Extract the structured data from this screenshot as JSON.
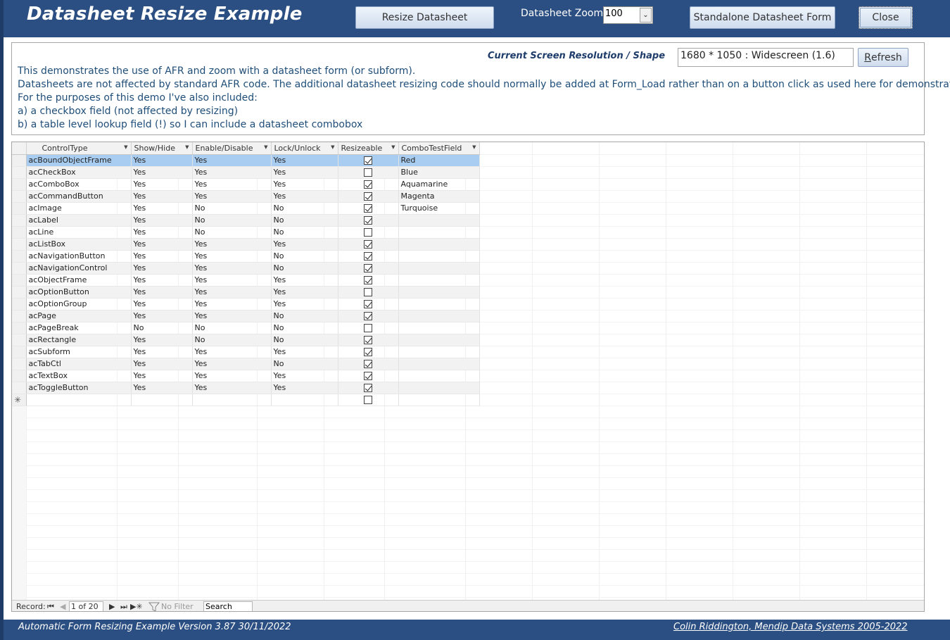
{
  "header": {
    "title": "Datasheet Resize Example",
    "resize_label": "Resize Datasheet",
    "zoom_label": "Datasheet Zoom",
    "zoom_value": "100",
    "standalone_label": "Standalone Datasheet Form",
    "close_label": "Close"
  },
  "info": {
    "resolution_label": "Current Screen Resolution / Shape",
    "resolution_value": "1680 * 1050 : Widescreen (1.6)",
    "refresh_first": "R",
    "refresh_rest": "efresh",
    "lines": [
      "This demonstrates the use of AFR and zoom with a datasheet form (or subform).",
      "Datasheets are not affected by standard AFR code. The additional datasheet resizing code should normally be added at Form_Load rather than on a button click as used here for demonstration",
      "For the purposes of this demo I've also included:",
      "a) a checkbox field (not affected by resizing)",
      "b) a table level lookup field (!) so I can include a datasheet combobox"
    ]
  },
  "datasheet": {
    "columns": [
      "ControlType",
      "Show/Hide",
      "Enable/Disable",
      "Lock/Unlock",
      "Resizeable",
      "ComboTestField"
    ],
    "rows": [
      {
        "type": "acBoundObjectFrame",
        "show": "Yes",
        "enable": "Yes",
        "lock": "Yes",
        "resizeable": true,
        "combo": "Red"
      },
      {
        "type": "acCheckBox",
        "show": "Yes",
        "enable": "Yes",
        "lock": "Yes",
        "resizeable": false,
        "combo": "Blue"
      },
      {
        "type": "acComboBox",
        "show": "Yes",
        "enable": "Yes",
        "lock": "Yes",
        "resizeable": true,
        "combo": "Aquamarine"
      },
      {
        "type": "acCommandButton",
        "show": "Yes",
        "enable": "Yes",
        "lock": "Yes",
        "resizeable": true,
        "combo": "Magenta"
      },
      {
        "type": "acImage",
        "show": "Yes",
        "enable": "No",
        "lock": "No",
        "resizeable": true,
        "combo": "Turquoise"
      },
      {
        "type": "acLabel",
        "show": "Yes",
        "enable": "No",
        "lock": "No",
        "resizeable": true,
        "combo": ""
      },
      {
        "type": "acLine",
        "show": "Yes",
        "enable": "No",
        "lock": "No",
        "resizeable": false,
        "combo": ""
      },
      {
        "type": "acListBox",
        "show": "Yes",
        "enable": "Yes",
        "lock": "Yes",
        "resizeable": true,
        "combo": ""
      },
      {
        "type": "acNavigationButton",
        "show": "Yes",
        "enable": "Yes",
        "lock": "No",
        "resizeable": true,
        "combo": ""
      },
      {
        "type": "acNavigationControl",
        "show": "Yes",
        "enable": "Yes",
        "lock": "No",
        "resizeable": true,
        "combo": ""
      },
      {
        "type": "acObjectFrame",
        "show": "Yes",
        "enable": "Yes",
        "lock": "Yes",
        "resizeable": true,
        "combo": ""
      },
      {
        "type": "acOptionButton",
        "show": "Yes",
        "enable": "Yes",
        "lock": "Yes",
        "resizeable": false,
        "combo": ""
      },
      {
        "type": "acOptionGroup",
        "show": "Yes",
        "enable": "Yes",
        "lock": "Yes",
        "resizeable": true,
        "combo": ""
      },
      {
        "type": "acPage",
        "show": "Yes",
        "enable": "Yes",
        "lock": "No",
        "resizeable": true,
        "combo": ""
      },
      {
        "type": "acPageBreak",
        "show": "No",
        "enable": "No",
        "lock": "No",
        "resizeable": false,
        "combo": ""
      },
      {
        "type": "acRectangle",
        "show": "Yes",
        "enable": "No",
        "lock": "No",
        "resizeable": true,
        "combo": ""
      },
      {
        "type": "acSubform",
        "show": "Yes",
        "enable": "Yes",
        "lock": "Yes",
        "resizeable": true,
        "combo": ""
      },
      {
        "type": "acTabCtl",
        "show": "Yes",
        "enable": "Yes",
        "lock": "No",
        "resizeable": true,
        "combo": ""
      },
      {
        "type": "acTextBox",
        "show": "Yes",
        "enable": "Yes",
        "lock": "Yes",
        "resizeable": true,
        "combo": ""
      },
      {
        "type": "acToggleButton",
        "show": "Yes",
        "enable": "Yes",
        "lock": "Yes",
        "resizeable": true,
        "combo": ""
      }
    ],
    "new_row_marker": "✳"
  },
  "navigator": {
    "record_label": "Record:",
    "record_value": "1 of 20",
    "filter_label": "No Filter",
    "search_value": "Search"
  },
  "footer": {
    "left": "Automatic Form Resizing Example   Version 3.87  30/11/2022",
    "right": "Colin Riddington, Mendip Data Systems 2005-2022"
  },
  "colors": {
    "header_bg": "#2b4f82",
    "selected_row": "#a9cdf0",
    "description_text": "#1f4e79"
  }
}
